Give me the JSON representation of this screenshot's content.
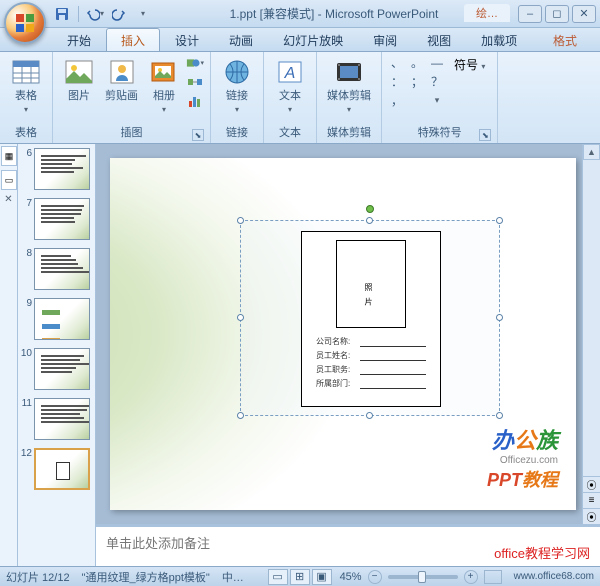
{
  "title": "1.ppt [兼容模式] - Microsoft PowerPoint",
  "context_tab": "绘…",
  "qat": {
    "save": "保存",
    "undo": "撤销",
    "redo": "恢复"
  },
  "tabs": [
    "开始",
    "插入",
    "设计",
    "动画",
    "幻灯片放映",
    "审阅",
    "视图",
    "加载项"
  ],
  "tabs_context": "格式",
  "active_tab_index": 1,
  "ribbon": {
    "tables": {
      "label": "表格",
      "table_btn": "表格"
    },
    "illustrations": {
      "label": "插图",
      "picture": "图片",
      "clipart": "剪贴画",
      "album": "相册",
      "shapes": "形状",
      "smartart": "SmartArt",
      "chart": "图表"
    },
    "links": {
      "label": "链接",
      "link_btn": "链接"
    },
    "text": {
      "label": "文本",
      "text_btn": "文本"
    },
    "media": {
      "label": "媒体剪辑",
      "media_btn": "媒体剪辑"
    },
    "symbols": {
      "label": "特殊符号",
      "symbol_btn": "符号"
    }
  },
  "thumbs": [
    {
      "n": "6",
      "type": "lines"
    },
    {
      "n": "7",
      "type": "lines"
    },
    {
      "n": "8",
      "type": "lines"
    },
    {
      "n": "9",
      "type": "blocks"
    },
    {
      "n": "10",
      "type": "lines"
    },
    {
      "n": "11",
      "type": "lines"
    },
    {
      "n": "12",
      "type": "box",
      "selected": true
    }
  ],
  "object": {
    "photo_label": "照 片",
    "fields": [
      {
        "label": "公司名称:"
      },
      {
        "label": "员工姓名:"
      },
      {
        "label": "员工职务:"
      },
      {
        "label": "所属部门:"
      }
    ]
  },
  "watermark": {
    "brand": "办公族",
    "domain": "Officezu.com",
    "line2a": "PPT",
    "line2b": "教程"
  },
  "notes_placeholder": "单击此处添加备注",
  "status": {
    "slide_counter": "幻灯片 12/12",
    "theme": "\"通用纹理_绿方格ppt模板\"",
    "lang": "中…",
    "zoom": "45%"
  },
  "credit": "office教程学习网",
  "credit_url": "www.office68.com"
}
